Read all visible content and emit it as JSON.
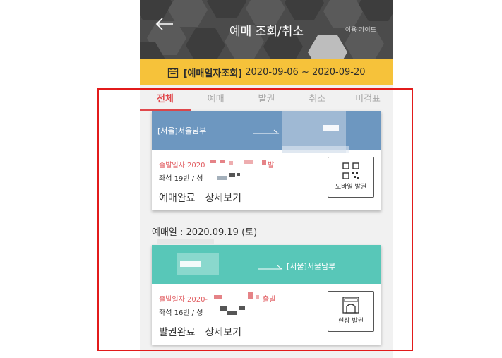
{
  "header": {
    "title": "예매 조회/취소",
    "guide_label": "이용 가이드"
  },
  "date_range": {
    "label": "[예매일자조회]",
    "value": "2020-09-06 ~ 2020-09-20"
  },
  "tabs": [
    {
      "label": "전체",
      "active": true
    },
    {
      "label": "예매",
      "active": false
    },
    {
      "label": "발권",
      "active": false
    },
    {
      "label": "취소",
      "active": false
    },
    {
      "label": "미검표",
      "active": false
    }
  ],
  "cards": [
    {
      "terminal": "[서울]서울남부",
      "departure": "출발일자 2020",
      "departure_suffix": "발",
      "seat": "좌석 19번 / 성",
      "status": "예매완료",
      "detail": "상세보기",
      "ticket_type": "모바일 발권"
    },
    {
      "terminal": "[서울]서울남부",
      "departure": "출발일자 2020-",
      "departure_suffix": "출발",
      "seat": "좌석 16번 / 성",
      "status": "발권완료",
      "detail": "상세보기",
      "ticket_type": "현장 발권"
    }
  ],
  "booking_date": "예매일 : 2020.09.19 (토)",
  "colors": {
    "header_bg": "#4b4b4b",
    "date_bar": "#f6c23a",
    "active_tab": "#e0484c",
    "card1_top": "#6d97c0",
    "card2_top": "#58c7b8",
    "highlight_box": "#e21b1b"
  },
  "icons": [
    "back-arrow-icon",
    "calendar-icon",
    "qr-code-icon",
    "ticket-booth-icon"
  ]
}
